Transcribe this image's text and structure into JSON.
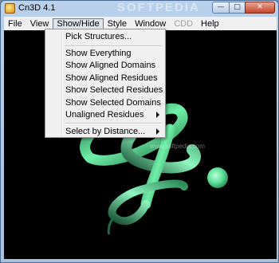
{
  "window": {
    "title": "Cn3D 4.1",
    "watermark": "SOFTPEDIA",
    "minimize_glyph": "—",
    "maximize_glyph": "□",
    "close_glyph": "✕",
    "app_icon": "cn3d-app-icon"
  },
  "menubar": {
    "items": [
      {
        "label": "File"
      },
      {
        "label": "View"
      },
      {
        "label": "Show/Hide"
      },
      {
        "label": "Style"
      },
      {
        "label": "Window"
      },
      {
        "label": "CDD"
      },
      {
        "label": "Help"
      }
    ],
    "active": "Show/Hide",
    "disabled": "CDD"
  },
  "dropdown": {
    "items": [
      {
        "label": "Pick Structures..."
      },
      {
        "label": "Show Everything"
      },
      {
        "label": "Show Aligned Domains"
      },
      {
        "label": "Show Aligned Residues"
      },
      {
        "label": "Show Selected Residues"
      },
      {
        "label": "Show Selected Domains"
      },
      {
        "label": "Unaligned Residues",
        "submenu": true
      },
      {
        "label": "Select by Distance...",
        "submenu": true
      }
    ]
  },
  "viewport": {
    "background": "#000000",
    "helix_color": "#4fd890",
    "watermark": "www.softpedia.com"
  }
}
